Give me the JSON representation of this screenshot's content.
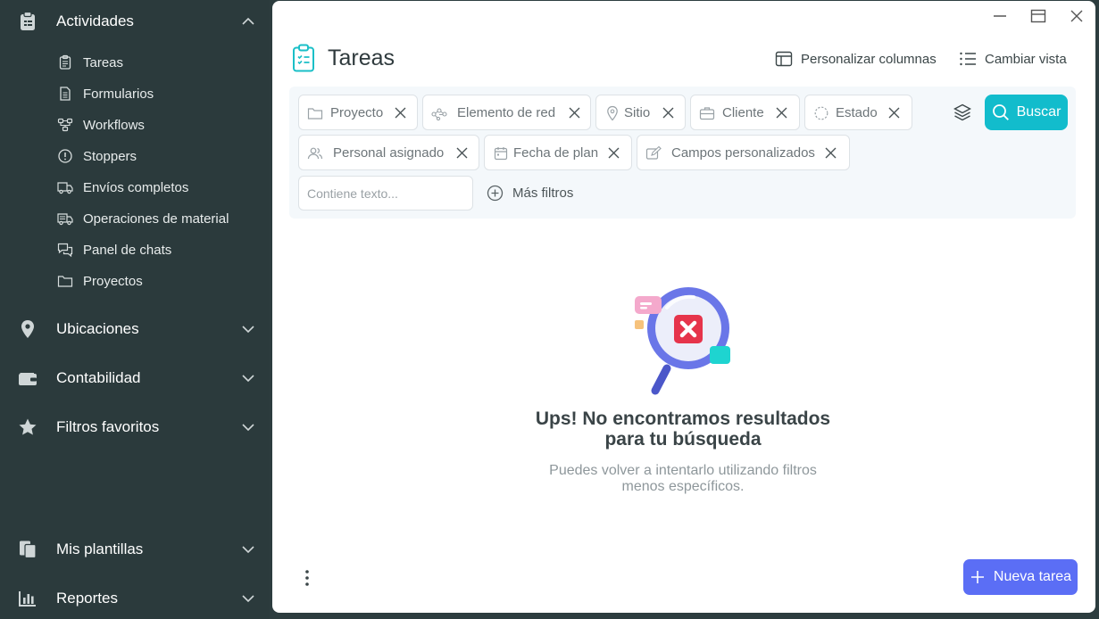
{
  "sidebar": {
    "sections": [
      {
        "label": "Actividades",
        "icon": "clipboard-icon",
        "expanded": true
      },
      {
        "label": "Ubicaciones",
        "icon": "location-pin-icon",
        "expanded": false
      },
      {
        "label": "Contabilidad",
        "icon": "wallet-icon",
        "expanded": false
      },
      {
        "label": "Filtros favoritos",
        "icon": "star-icon",
        "expanded": false
      },
      {
        "label": "Mis plantillas",
        "icon": "templates-icon",
        "expanded": false
      },
      {
        "label": "Reportes",
        "icon": "bar-chart-icon",
        "expanded": false
      }
    ],
    "activity_items": [
      {
        "label": "Tareas",
        "icon": "task-clipboard-icon"
      },
      {
        "label": "Formularios",
        "icon": "form-icon"
      },
      {
        "label": "Workflows",
        "icon": "workflow-icon"
      },
      {
        "label": "Stoppers",
        "icon": "alert-circle-icon"
      },
      {
        "label": "Envíos completos",
        "icon": "truck-icon"
      },
      {
        "label": "Operaciones de material",
        "icon": "material-truck-icon"
      },
      {
        "label": "Panel de chats",
        "icon": "chat-icon"
      },
      {
        "label": "Proyectos",
        "icon": "folder-icon"
      }
    ]
  },
  "header": {
    "title": "Tareas",
    "customize_columns": "Personalizar columnas",
    "change_view": "Cambiar vista"
  },
  "filters": {
    "chips": [
      {
        "label": "Proyecto",
        "icon": "folder-icon"
      },
      {
        "label": "Elemento de red",
        "icon": "network-icon"
      },
      {
        "label": "Sitio",
        "icon": "location-pin-icon"
      },
      {
        "label": "Cliente",
        "icon": "briefcase-icon"
      },
      {
        "label": "Estado",
        "icon": "status-dashed-circle-icon"
      },
      {
        "label": "Personal asignado",
        "icon": "people-icon"
      },
      {
        "label": "Fecha de plan",
        "icon": "calendar-icon"
      },
      {
        "label": "Campos personalizados",
        "icon": "edit-field-icon"
      }
    ],
    "text_placeholder": "Contiene texto...",
    "text_value": "",
    "more_filters": "Más filtros",
    "search_button": "Buscar"
  },
  "empty_state": {
    "title_line1": "Ups! No encontramos resultados",
    "title_line2": "para tu búsqueda",
    "subtitle_line1": "Puedes volver a intentarlo utilizando filtros",
    "subtitle_line2": "menos específicos."
  },
  "footer": {
    "new_task_button": "Nueva tarea"
  },
  "colors": {
    "sidebar_bg": "#2b3a3c",
    "accent_teal": "#12bccc",
    "primary_button": "#5b6ef5",
    "filter_bg": "#f4f8fb"
  }
}
